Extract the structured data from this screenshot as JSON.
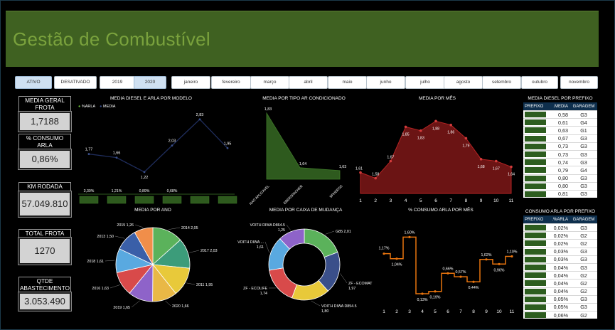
{
  "title": "Gestão de Combustível",
  "slicers": [
    {
      "label": "ATIVO",
      "selected": true
    },
    {
      "label": "DESATIVADO",
      "selected": false
    },
    {
      "label": "2019",
      "selected": false
    },
    {
      "label": "2020",
      "selected": true
    },
    {
      "label": "janeiro",
      "selected": false
    },
    {
      "label": "fevereiro",
      "selected": false
    },
    {
      "label": "março",
      "selected": false
    },
    {
      "label": "abril",
      "selected": false
    },
    {
      "label": "maio",
      "selected": false
    },
    {
      "label": "junho",
      "selected": false
    },
    {
      "label": "julho",
      "selected": false
    },
    {
      "label": "agosto",
      "selected": false
    },
    {
      "label": "setembro",
      "selected": false
    },
    {
      "label": "outubro",
      "selected": false
    },
    {
      "label": "novembro",
      "selected": false
    }
  ],
  "kpis": [
    {
      "label": "MEDIA GERAL FROTA",
      "value": "1,7188"
    },
    {
      "label": "% CONSUMO ARLA",
      "value": "0,86%"
    },
    {
      "label": "KM RODADA",
      "value": "57.049.810"
    },
    {
      "label": "TOTAL FROTA",
      "value": "1270"
    },
    {
      "label": "QTDE ABASTECIMENTO",
      "value": "3.053.490"
    }
  ],
  "colors": {
    "header": "#3f6121",
    "title_text": "#7aa23d",
    "green_area": "#2e5a1e",
    "red_area": "#6b1414",
    "orange_line": "#e8740e",
    "navy_line": "#1f2d5c",
    "table_header": "#0e2f4d"
  },
  "chart_data": [
    {
      "type": "line",
      "title": "MEDIA DIESEL E ARLA POR MODELO",
      "legend": [
        {
          "name": "%ARLA",
          "color": "#6bbf3a"
        },
        {
          "name": "MEDIA",
          "color": "#3a4f8a"
        }
      ],
      "series": [
        {
          "name": "MEDIA",
          "values": [
            1.77,
            1.66,
            1.22,
            2.03,
            2.83,
            1.95
          ],
          "labels": [
            "1,77",
            "1,66",
            "1,22",
            "2,03",
            "2,83",
            "1,95"
          ]
        },
        {
          "name": "%ARLA",
          "type": "bar",
          "values": [
            3.3,
            1.21,
            0.89,
            0.68,
            null,
            null
          ],
          "labels": [
            "3,30%",
            "1,21%",
            "0,89%",
            "0,68%",
            "",
            ""
          ]
        }
      ]
    },
    {
      "type": "area",
      "title": "MEDIA POR TIPO AR CONDICIONADO",
      "categories": [
        "NAO APLICAVEL",
        "EBERSPACHER",
        "SPHEROS"
      ],
      "values": [
        1.83,
        1.64,
        1.63
      ],
      "labels": [
        "1,83",
        "1,64",
        "1,63"
      ]
    },
    {
      "type": "area",
      "title": "MEDIA POR MÊS",
      "categories": [
        "1",
        "2",
        "3",
        "4",
        "5",
        "6",
        "7",
        "8",
        "9",
        "10",
        "11"
      ],
      "values": [
        1.61,
        1.58,
        1.67,
        1.85,
        1.83,
        1.88,
        1.86,
        1.79,
        1.68,
        1.67,
        1.64
      ],
      "labels": [
        "1,61",
        "1,58",
        "1,67",
        "1,85",
        "1,83",
        "1,88",
        "1,86",
        "1,79",
        "1,68",
        "1,67",
        "1,64"
      ]
    },
    {
      "type": "pie",
      "title": "MEDIA POR ANO",
      "slices": [
        {
          "label": "2014 2,05",
          "value": 2.05,
          "color": "#5bb25b"
        },
        {
          "label": "2017 2,03",
          "value": 2.03,
          "color": "#3c9c7a"
        },
        {
          "label": "2011 1,95",
          "value": 1.95,
          "color": "#e8c93a"
        },
        {
          "label": "2020 1,66",
          "value": 1.66,
          "color": "#e9b846"
        },
        {
          "label": "2019 1,65",
          "value": 1.65,
          "color": "#8e63c9"
        },
        {
          "label": "2016 1,63",
          "value": 1.63,
          "color": "#d84a4a"
        },
        {
          "label": "2018 1,61",
          "value": 1.61,
          "color": "#59a9e0"
        },
        {
          "label": "2013 1,50",
          "value": 1.5,
          "color": "#3a5fa8"
        },
        {
          "label": "2015 1,26",
          "value": 1.26,
          "color": "#f08e4a"
        }
      ]
    },
    {
      "type": "pie",
      "title": "MEDIA POR CAIXA DE MUDANÇA",
      "slices": [
        {
          "label": "G85 2,01",
          "value": 2.01,
          "color": "#5bb25b"
        },
        {
          "label": "ZF - ECOMAT 1,97",
          "value": 1.97,
          "color": "#3a4f8a"
        },
        {
          "label": "VOITH DIWA D854.5 1,80",
          "value": 1.8,
          "color": "#e8c93a"
        },
        {
          "label": "ZF - ECOLIFE 1,74",
          "value": 1.74,
          "color": "#d84a4a"
        },
        {
          "label": "VOITH DIWA ... 1,61",
          "value": 1.61,
          "color": "#59a9e0"
        },
        {
          "label": "VOITH DIWA D864.5 1,25",
          "value": 1.25,
          "color": "#8e63c9"
        }
      ]
    },
    {
      "type": "line",
      "title": "% CONSUMO ARLA POR MÊS",
      "categories": [
        "1",
        "2",
        "3",
        "4",
        "5",
        "6",
        "7",
        "8",
        "9",
        "10",
        "11"
      ],
      "values": [
        1.17,
        1.04,
        1.6,
        0.13,
        0.19,
        0.66,
        0.57,
        0.44,
        1.02,
        0.9,
        1.1
      ],
      "labels": [
        "1,17%",
        "1,04%",
        "1,60%",
        "0,13%",
        "0,19%",
        "0,66%",
        "0,57%",
        "0,44%",
        "1,02%",
        "0,90%",
        "1,10%"
      ]
    }
  ],
  "table_diesel": {
    "title": "MEDIA DIESEL POR PREFIXO",
    "headers": [
      "PREFIXO",
      ".MEDIA",
      "GARAGEM"
    ],
    "rows": [
      [
        "0,58",
        "G3"
      ],
      [
        "0,61",
        "G4"
      ],
      [
        "0,63",
        "G1"
      ],
      [
        "0,67",
        "G3"
      ],
      [
        "0,73",
        "G3"
      ],
      [
        "0,73",
        "G3"
      ],
      [
        "0,74",
        "G3"
      ],
      [
        "0,79",
        "G4"
      ],
      [
        "0,80",
        "G3"
      ],
      [
        "0,80",
        "G3"
      ],
      [
        "0,81",
        "G3"
      ]
    ]
  },
  "table_arla": {
    "title": "CONSUMO ARLA POR PREFIXO",
    "headers": [
      "PREFIXO",
      ".%ARLA",
      "GARAGEM"
    ],
    "rows": [
      [
        "0,02%",
        "G3"
      ],
      [
        "0,02%",
        "G2"
      ],
      [
        "0,02%",
        "G2"
      ],
      [
        "0,03%",
        "G3"
      ],
      [
        "0,03%",
        "G3"
      ],
      [
        "0,04%",
        "G3"
      ],
      [
        "0,04%",
        "G2"
      ],
      [
        "0,04%",
        "G2"
      ],
      [
        "0,04%",
        "G2"
      ],
      [
        "0,05%",
        "G3"
      ],
      [
        "0,05%",
        "G3"
      ],
      [
        "0,06%",
        "G2"
      ]
    ]
  }
}
